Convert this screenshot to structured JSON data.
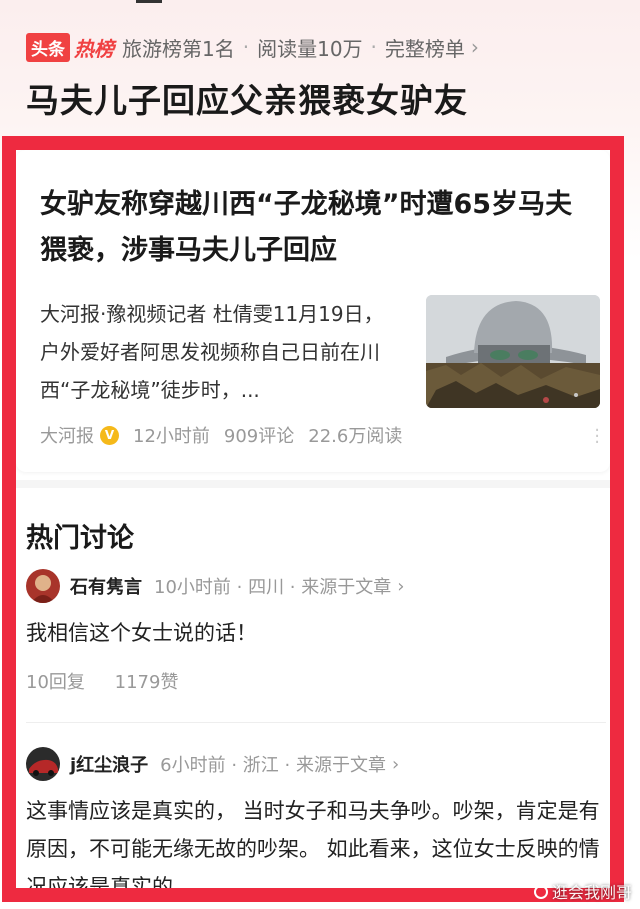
{
  "hot_bar": {
    "brand_toutiao": "头条",
    "brand_rebang": "热榜",
    "rank": "旅游榜第1名",
    "dot": "·",
    "reads": "阅读量10万",
    "full_list": "完整榜单"
  },
  "headline": "马夫儿子回应父亲猥亵女驴友",
  "article": {
    "title": "女驴友称穿越川西“子龙秘境”时遭65岁马夫猥亵，涉事马夫儿子回应",
    "summary": "大河报·豫视频记者 杜倩雯11月19日，户外爱好者阿思发视频称自己日前在川西“子龙秘境”徒步时，...",
    "source": "大河报",
    "verified_mark": "V",
    "time": "12小时前",
    "comments": "909评论",
    "reads": "22.6万阅读"
  },
  "discussion": {
    "title": "热门讨论",
    "comments": [
      {
        "user": "石有隽言",
        "meta": "10小时前 · 四川 · 来源于文章",
        "text": "我相信这个女士说的话！",
        "replies": "10回复",
        "likes": "1179赞"
      },
      {
        "user": "j红尘浪子",
        "meta": "6小时前 · 浙江 · 来源于文章",
        "text": "这事情应该是真实的， 当时女子和马夫争吵。吵架，肯定是有原因，不可能无缘无故的吵架。 如此看来，这位女士反映的情况应该是真实的"
      }
    ]
  },
  "watermark": "逛会我刚哥",
  "colors": {
    "accent_red": "#ee2a40",
    "brand_red": "#f04142",
    "verified_gold": "#f5b91a"
  },
  "icons": {
    "chevron": "chevron-right-icon",
    "more": "more-vertical-icon"
  }
}
